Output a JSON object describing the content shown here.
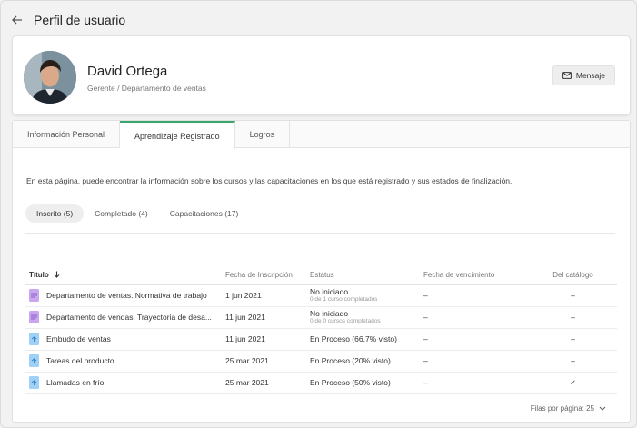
{
  "header": {
    "title": "Perfil de usuario"
  },
  "profile": {
    "name": "David Ortega",
    "role": "Gerente / Departamento de ventas",
    "message_button": "Mensaje"
  },
  "tabs": [
    {
      "label": "Información Personal"
    },
    {
      "label": "Aprendizaje Registrado"
    },
    {
      "label": "Logros"
    }
  ],
  "intro": "En esta página, puede encontrar la información sobre los cursos y las capacitaciones en los que está registrado y sus estados de finalización.",
  "filters": [
    {
      "label": "Inscrito (5)"
    },
    {
      "label": "Completado (4)"
    },
    {
      "label": "Capacitaciones (17)"
    }
  ],
  "table": {
    "headers": {
      "title": "Título",
      "enrolled": "Fecha de Inscripción",
      "status": "Estatus",
      "due": "Fecha de vencimiento",
      "catalog": "Del catálogo"
    },
    "rows": [
      {
        "title": "Departamento de ventas. Normativa de trabajo",
        "enrolled": "1 jun 2021",
        "status": "No iniciado",
        "status_sub": "0 de 1 curso completados",
        "due": "–",
        "catalog": "–"
      },
      {
        "title": "Departamento de vendas. Trayectoria de desa...",
        "enrolled": "11 jun 2021",
        "status": "No iniciado",
        "status_sub": "0 de 0 cursos completados",
        "due": "–",
        "catalog": "–"
      },
      {
        "title": "Embudo de ventas",
        "enrolled": "11 jun 2021",
        "status": "En Proceso (66.7% visto)",
        "status_sub": "",
        "due": "–",
        "catalog": "–"
      },
      {
        "title": "Tareas del producto",
        "enrolled": "25 mar 2021",
        "status": "En Proceso (20% visto)",
        "status_sub": "",
        "due": "–",
        "catalog": "–"
      },
      {
        "title": "Llamadas en frío",
        "enrolled": "25 mar 2021",
        "status": "En Proceso (50% visto)",
        "status_sub": "",
        "due": "–",
        "catalog": "✓"
      }
    ]
  },
  "pager": {
    "label": "Filas por página: 25"
  },
  "colors": {
    "accent_tab": "#3aa76d",
    "link": "#3a82d6",
    "doc_purple": "#c9a7ef",
    "doc_blue": "#9fd0f5"
  }
}
